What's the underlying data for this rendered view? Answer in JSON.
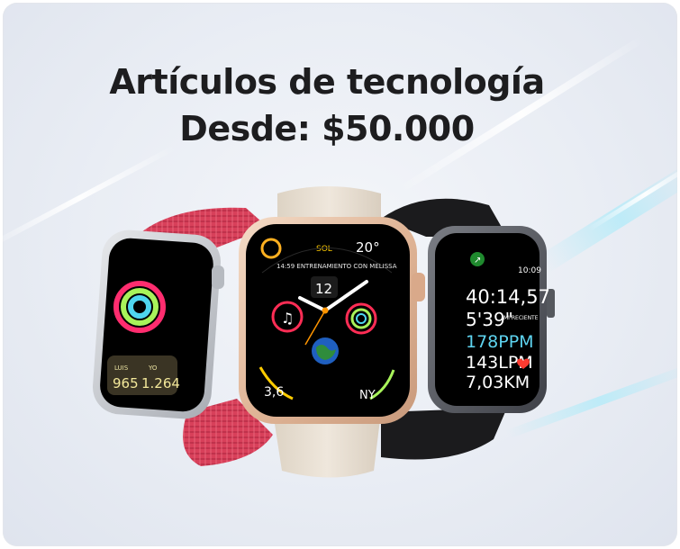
{
  "banner": {
    "title": "Artículos de tecnología",
    "subtitle": "Desde: $50.000"
  },
  "watch_left": {
    "stat_left_label": "LUIS",
    "stat_left_value": "965",
    "stat_right_label": "YO",
    "stat_right_value": "1.264"
  },
  "watch_center": {
    "top_left": "SOL",
    "top_right": "20°",
    "arc_text": "14:59 ENTRENAMIENTO CON MELISSA",
    "date": "12",
    "bottom_left": "3,6",
    "bottom_right": "NY"
  },
  "watch_right": {
    "time": "10:09",
    "elapsed": "40:14,57",
    "split": "5'39\"",
    "split_note": "MI RECIENTE",
    "cadence": "178PPM",
    "heart": "143LPM",
    "distance": "7,03KM"
  },
  "colors": {
    "band_left": "#d8405a",
    "band_center": "#e9e0d3",
    "band_right": "#1b1b1d",
    "case_gold": "#e8c4a8",
    "case_silver": "#c9ccd1",
    "case_gray": "#5c5f66",
    "accent_yellow": "#e3f21c",
    "accent_cyan": "#5ed4f0"
  }
}
